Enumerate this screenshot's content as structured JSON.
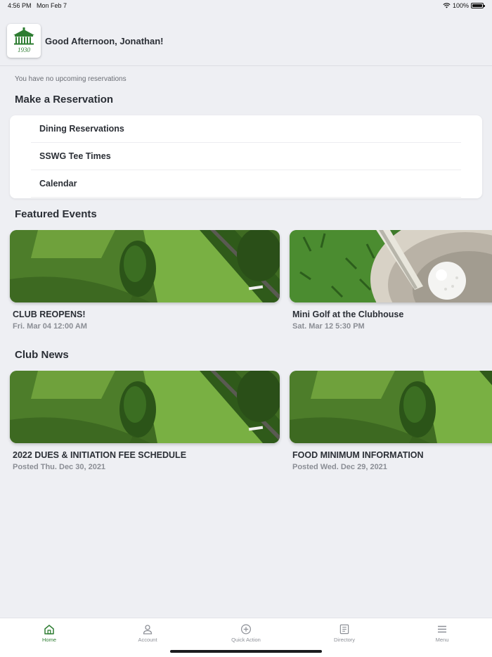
{
  "status": {
    "time": "4:56 PM",
    "date": "Mon Feb 7",
    "battery": "100%"
  },
  "header": {
    "greeting": "Good Afternoon, Jonathan!",
    "logo_year": "1930"
  },
  "reservations": {
    "notice": "You have no upcoming reservations",
    "title": "Make a Reservation",
    "items": [
      "Dining Reservations",
      "SSWG Tee Times",
      "Calendar"
    ]
  },
  "events": {
    "title": "Featured Events",
    "items": [
      {
        "title": "CLUB REOPENS!",
        "subtitle": "Fri. Mar 04 12:00 AM",
        "image": "golf-course-aerial"
      },
      {
        "title": "Mini Golf at the Clubhouse",
        "subtitle": "Sat. Mar 12 5:30 PM",
        "image": "golf-ball-in-cup"
      }
    ]
  },
  "news": {
    "title": "Club News",
    "items": [
      {
        "title": "2022 DUES & INITIATION FEE SCHEDULE",
        "subtitle": "Posted Thu. Dec 30, 2021",
        "image": "golf-course-aerial"
      },
      {
        "title": "FOOD MINIMUM INFORMATION",
        "subtitle": "Posted Wed. Dec 29, 2021",
        "image": "golf-course-aerial"
      }
    ]
  },
  "tabs": [
    {
      "label": "Home",
      "icon": "home-icon",
      "active": true
    },
    {
      "label": "Account",
      "icon": "person-icon",
      "active": false
    },
    {
      "label": "Quick Action",
      "icon": "plus-circle-icon",
      "active": false
    },
    {
      "label": "Directory",
      "icon": "directory-icon",
      "active": false
    },
    {
      "label": "Menu",
      "icon": "hamburger-icon",
      "active": false
    }
  ],
  "colors": {
    "accent": "#2e7d32",
    "background": "#eeeff3",
    "text": "#2b2f36",
    "muted": "#8b8e95"
  }
}
